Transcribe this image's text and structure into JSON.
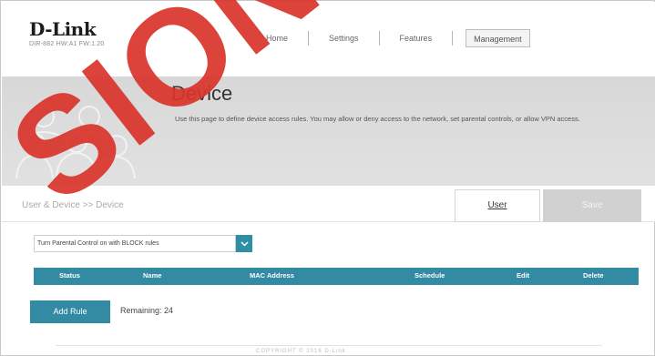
{
  "brand": {
    "logo": "D-Link",
    "model": "DIR-882 HW:A1 FW:1.20"
  },
  "nav": {
    "home": "Home",
    "settings": "Settings",
    "features": "Features",
    "management": "Management"
  },
  "banner": {
    "title": "Device",
    "description": "Use this page to define device access rules. You may allow or deny access to the network, set parental controls, or allow VPN access."
  },
  "subbar": {
    "breadcrumb": "User & Device >> Device",
    "user_button": "User",
    "save_button": "Save"
  },
  "filter": {
    "selected": "Turn Parental Control on with BLOCK rules"
  },
  "table": {
    "columns": [
      "Status",
      "Name",
      "MAC Address",
      "Schedule",
      "Edit",
      "Delete"
    ]
  },
  "rules": {
    "add_button": "Add Rule",
    "remaining": "Remaining: 24"
  },
  "footer": {
    "text": "COPYRIGHT © 2016 D-Link"
  },
  "watermark": {
    "text": "SION"
  },
  "colors": {
    "accent": "#328ba2",
    "banner_bg": "#dcdcdc",
    "watermark": "#d9342b"
  }
}
